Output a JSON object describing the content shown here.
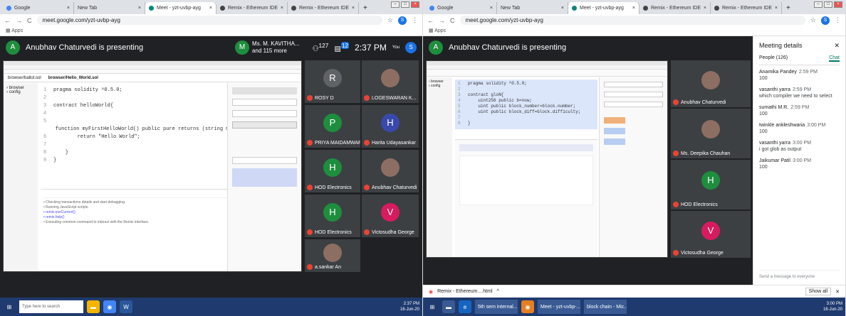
{
  "browser": {
    "tabs": [
      "Google",
      "New Tab",
      "Meet - yzt-uvbp-ayg",
      "Remix - Ethereum IDE",
      "Remix - Ethereum IDE"
    ],
    "url": "meet.google.com/yzt-uvbp-ayg",
    "bookmarks_label": "Apps"
  },
  "left": {
    "presenter": "Anubhav Chaturvedi is presenting",
    "presenter_initial": "A",
    "you_caption": "Ms. M. KAVITHA...",
    "you_sub": "and 115 more",
    "you_initial": "M",
    "people_count": "127",
    "chat_count": "12",
    "clock": "2:37 PM",
    "you_label": "You",
    "you_avatar": "S",
    "editor_tabs": [
      "browser/ballot.sol",
      "browser/Hello_World.sol"
    ],
    "code": [
      "pragma solidity ^0.5.0;",
      "",
      "contract helloWorld{",
      "",
      "    function myFirstHelloWorld() public pure returns (string memory){",
      "        return \"Hello World\";",
      "",
      "    }",
      "}"
    ],
    "tiles": [
      {
        "initial": "R",
        "name": "ROSY D",
        "color": "#5f6368"
      },
      {
        "initial": "",
        "name": "LOGESWARAN K...",
        "color": "#3c4043"
      },
      {
        "initial": "P",
        "name": "PRIYA MAIDAMWAR",
        "color": "#1e8e3e"
      },
      {
        "initial": "H",
        "name": "Harita Udayasankar",
        "color": "#3949ab"
      },
      {
        "initial": "H",
        "name": "HOD Electronics",
        "color": "#1e8e3e"
      },
      {
        "initial": "",
        "name": "Anubhav Chaturvedi",
        "color": "#3c4043"
      },
      {
        "initial": "H",
        "name": "HOD Electronics",
        "color": "#1e8e3e"
      },
      {
        "initial": "V",
        "name": "Victosudha George",
        "color": "#d81b60"
      },
      {
        "initial": "",
        "name": "a.sankar An",
        "color": "#3c4043"
      }
    ],
    "search_placeholder": "Type here to search",
    "taskbar_time": "2:37 PM",
    "taskbar_date": "16-Jun-20"
  },
  "right": {
    "presenter": "Anubhav Chaturvedi is presenting",
    "presenter_initial": "A",
    "code": [
      "pragma solidity ^0.5.0;",
      "",
      "contract gloN{",
      "    uint256 public b=now;",
      "    uint public block_number=block.number;",
      "    uint public block_diff=block.difficulty;",
      "",
      "}"
    ],
    "tiles": [
      {
        "initial": "",
        "name": "Anubhav Chaturvedi",
        "color": "#3c4043"
      },
      {
        "initial": "",
        "name": "Ms. Deepika Chauhan",
        "color": "#3c4043"
      },
      {
        "initial": "H",
        "name": "HOD Electronics",
        "color": "#1e8e3e"
      },
      {
        "initial": "V",
        "name": "Victosudha George",
        "color": "#d81b60"
      }
    ],
    "details_title": "Meeting details",
    "people_tab": "People (126)",
    "chat_tab": "Chat",
    "messages": [
      {
        "who": "Anamika Pandey",
        "time": "2:59 PM",
        "text": "100"
      },
      {
        "who": "vasanthi yarra",
        "time": "2:59 PM",
        "text": "which compiler we need to select"
      },
      {
        "who": "sumathi M.R.",
        "time": "2:59 PM",
        "text": "100"
      },
      {
        "who": "twinkle ankleshwaria",
        "time": "3:00 PM",
        "text": "100"
      },
      {
        "who": "vasanthi yarra",
        "time": "3:00 PM",
        "text": "i got glob as output"
      },
      {
        "who": "Jaikumar Patil",
        "time": "3:00 PM",
        "text": "100"
      }
    ],
    "message_placeholder": "Send a message to everyone",
    "download_file": "Remix - Ethereum....html",
    "show_all": "Show all",
    "taskbar_time": "3:00 PM",
    "taskbar_date": "16-Jun-20",
    "taskbar_items": [
      "5th sem internal...",
      "Meet - yzt-uvbp-...",
      "block chain - Mic..."
    ]
  }
}
